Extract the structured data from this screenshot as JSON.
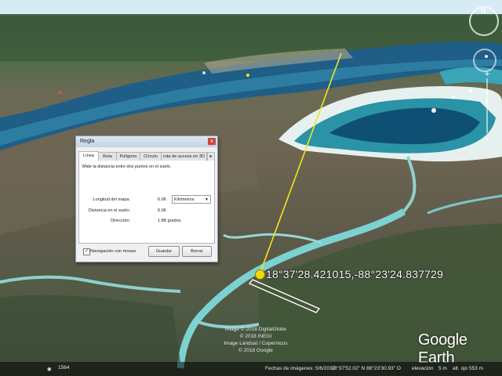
{
  "dialog": {
    "title": "Regla",
    "close_glyph": "x",
    "tabs": [
      "Línea",
      "Ruta",
      "Polígono",
      "Círculo",
      "ruta de acceso en 3D"
    ],
    "tab_scroll_glyph": "▸",
    "description": "Mide la distancia entre dos puntos en el suelo.",
    "map_length_label": "Longitud del mapa:",
    "map_length_value": "6.06",
    "unit": "Kilómetros",
    "ground_length_label": "Distancia en el suelo:",
    "ground_length_value": "6.06",
    "heading_label": "Dirección:",
    "heading_value": "1.88 grados",
    "mouse_nav_label": "Navegación con mouse",
    "mouse_nav_checked": true,
    "save_label": "Guardar",
    "clear_label": "Borrar"
  },
  "map": {
    "coordinate_label": "18°37'28.421015,-88°23'24.837729",
    "attribution": [
      "Image © 2018 DigitalGlobe",
      "© 2018 INEGI",
      "Image Landsat / Copernicus",
      "© 2018 Google"
    ],
    "logo": "Google Earth",
    "nav_north": "N",
    "zoom_in_glyph": "+",
    "zoom_out_glyph": "−",
    "ruler_color": "#f2e71c"
  },
  "status_bar": {
    "scale": "1564",
    "imagery_date": "Fechas de imágenes: 5/6/2017",
    "coordinates": "18°37'52.02\" N   88°23'30.93\" O",
    "elevation_label": "elevación",
    "elevation_value": "5 m",
    "eye_altitude": "alt. ojo   553 m"
  }
}
